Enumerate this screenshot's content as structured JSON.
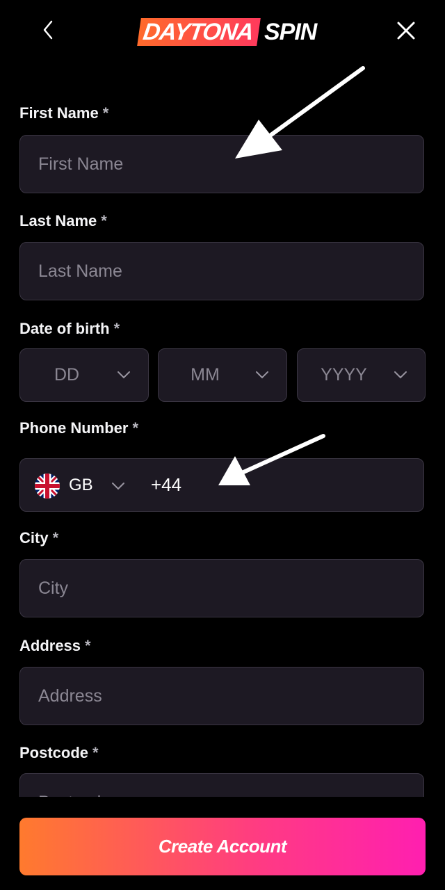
{
  "header": {
    "logo_part1": "DAYTONA",
    "logo_part2": "SPIN"
  },
  "form": {
    "first_name": {
      "label": "First Name",
      "required_mark": "*",
      "placeholder": "First Name"
    },
    "last_name": {
      "label": "Last Name",
      "required_mark": "*",
      "placeholder": "Last Name"
    },
    "dob": {
      "label": "Date of birth",
      "required_mark": "*",
      "day_placeholder": "DD",
      "month_placeholder": "MM",
      "year_placeholder": "YYYY"
    },
    "phone": {
      "label": "Phone Number",
      "required_mark": "*",
      "country_code": "GB",
      "dial_code": "+44",
      "flag_icon": "uk-flag-icon"
    },
    "city": {
      "label": "City",
      "required_mark": "*",
      "placeholder": "City"
    },
    "address": {
      "label": "Address",
      "required_mark": "*",
      "placeholder": "Address"
    },
    "postcode": {
      "label": "Postcode",
      "required_mark": "*",
      "placeholder": "Postcode"
    }
  },
  "cta": {
    "label": "Create Account"
  },
  "colors": {
    "background": "#000000",
    "field_bg": "#1d1923",
    "field_border": "#3a3542",
    "brand_orange": "#ff6a2b",
    "brand_pink": "#ff1fb0"
  },
  "icons": [
    "chevron-left-icon",
    "close-icon",
    "chevron-down-icon",
    "uk-flag-icon",
    "annotation-arrow"
  ]
}
